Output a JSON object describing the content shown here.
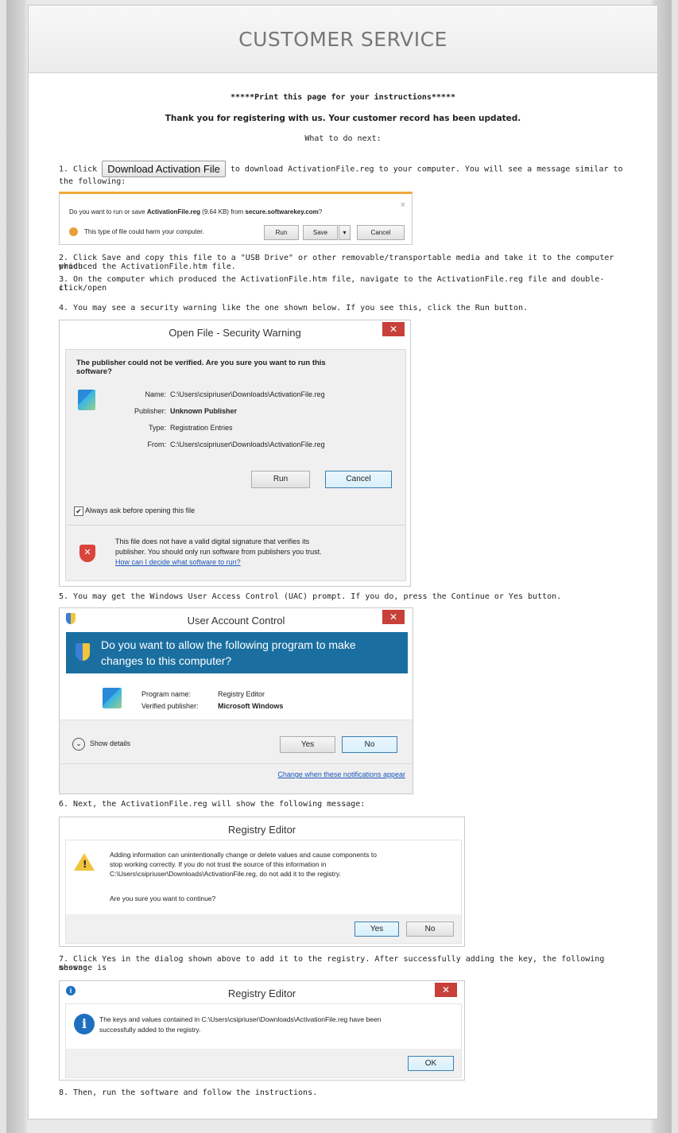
{
  "header": {
    "title": "CUSTOMER SERVICE"
  },
  "intro": {
    "print_note": "*****Print this page for your instructions*****",
    "thanks": "Thank you for registering with us. Your customer record has been updated.",
    "next": "What to do next:"
  },
  "steps": {
    "s1_prefix": "1. Click",
    "s1_button": "Download Activation File",
    "s1_suffix": "to download ActivationFile.reg to your computer. You will see a message similar to",
    "s1_line2": "the following:",
    "s2_line1": "2. Click Save and copy this file to a \"USB Drive\" or other removable/transportable media and take it to the computer which",
    "s2_line2": "produced the ActivationFile.htm file.",
    "s3_line1": "3. On the computer which produced the ActivationFile.htm file, navigate to the ActivationFile.reg file and double-click/open",
    "s3_line2": "it.",
    "s4": "4. You may see a security warning like the one shown below. If you see this, click the Run button.",
    "s5": "5. You may get the Windows User Access Control (UAC) prompt. If you do, press the Continue or Yes button.",
    "s6": "6. Next, the ActivationFile.reg will show the following message:",
    "s7_line1": "7. Click Yes in the dialog shown above to add it to the registry. After successfully adding the key, the following message is",
    "s7_line2": "shown:",
    "s8": "8. Then, run the software and follow the instructions."
  },
  "download_bar": {
    "q_prefix": "Do you want to run or save ",
    "q_file": "ActivationFile.reg",
    "q_size": " (9.64 KB) from ",
    "q_host": "secure.softwarekey.com",
    "q_end": "?",
    "warning": "This type of file could harm your computer.",
    "run": "Run",
    "save": "Save",
    "cancel": "Cancel",
    "close": "×",
    "arrow": "▾"
  },
  "security_warning": {
    "title": "Open File - Security Warning",
    "close": "✕",
    "question": "The publisher could not be verified.  Are you sure you want to run this software?",
    "rows": [
      {
        "label": "Name:",
        "value": "C:\\Users\\csipriuser\\Downloads\\ActivationFile.reg"
      },
      {
        "label": "Publisher:",
        "value": "Unknown Publisher"
      },
      {
        "label": "Type:",
        "value": "Registration Entries"
      },
      {
        "label": "From:",
        "value": "C:\\Users\\csipriuser\\Downloads\\ActivationFile.reg"
      }
    ],
    "run": "Run",
    "cancel": "Cancel",
    "checkbox": "Always ask before opening this file",
    "checked": true,
    "footer1": "This file does not have a valid digital signature that verifies its",
    "footer2": "publisher.  You should only run software from publishers you trust.",
    "footer_link": "How can I decide what software to run?"
  },
  "uac": {
    "title": "User Account Control",
    "close": "✕",
    "banner1": "Do you want to allow the following program to make",
    "banner2": "changes to this computer?",
    "program_label": "Program name:",
    "program_value": "Registry Editor",
    "publisher_label": "Verified publisher:",
    "publisher_value": "Microsoft Windows",
    "show_details": "Show details",
    "yes": "Yes",
    "no": "No",
    "link": "Change when these notifications appear",
    "banner_color": "#1a6fa0"
  },
  "reg_confirm": {
    "title": "Registry Editor",
    "line1": "Adding information can unintentionally change or delete values and cause components to",
    "line2": "stop working correctly. If you do not trust the source of this information in",
    "line3": "C:\\Users\\csipriuser\\Downloads\\ActivationFile.reg, do not add it to the registry.",
    "question": "Are you sure you want to continue?",
    "yes": "Yes",
    "no": "No"
  },
  "reg_success": {
    "title": "Registry Editor",
    "close": "✕",
    "line1": "The keys and values contained in C:\\Users\\csipriuser\\Downloads\\ActivationFile.reg have been",
    "line2": "successfully added to the registry.",
    "ok": "OK"
  }
}
